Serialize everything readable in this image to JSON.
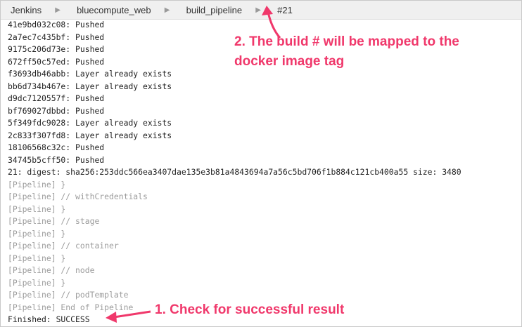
{
  "breadcrumb": {
    "items": [
      {
        "label": "Jenkins"
      },
      {
        "label": "bluecompute_web"
      },
      {
        "label": "build_pipeline"
      },
      {
        "label": "#21"
      }
    ]
  },
  "console": {
    "lines": [
      {
        "text": "41e9bd032c08: Pushed",
        "style": "normal"
      },
      {
        "text": "2a7ec7c435bf: Pushed",
        "style": "normal"
      },
      {
        "text": "9175c206d73e: Pushed",
        "style": "normal"
      },
      {
        "text": "672ff50c57ed: Pushed",
        "style": "normal"
      },
      {
        "text": "f3693db46abb: Layer already exists",
        "style": "normal"
      },
      {
        "text": "bb6d734b467e: Layer already exists",
        "style": "normal"
      },
      {
        "text": "d9dc7120557f: Pushed",
        "style": "normal"
      },
      {
        "text": "bf769027dbbd: Pushed",
        "style": "normal"
      },
      {
        "text": "5f349fdc9028: Layer already exists",
        "style": "normal"
      },
      {
        "text": "2c833f307fd8: Layer already exists",
        "style": "normal"
      },
      {
        "text": "18106568c32c: Pushed",
        "style": "normal"
      },
      {
        "text": "34745b5cff50: Pushed",
        "style": "normal"
      },
      {
        "text": "21: digest: sha256:253ddc566ea3407dae135e3b81a4843694a7a56c5bd706f1b884c121cb400a55 size: 3480",
        "style": "normal"
      },
      {
        "text": "[Pipeline] }",
        "style": "grey"
      },
      {
        "text": "[Pipeline] // withCredentials",
        "style": "grey"
      },
      {
        "text": "[Pipeline] }",
        "style": "grey"
      },
      {
        "text": "[Pipeline] // stage",
        "style": "grey"
      },
      {
        "text": "[Pipeline] }",
        "style": "grey"
      },
      {
        "text": "[Pipeline] // container",
        "style": "grey"
      },
      {
        "text": "[Pipeline] }",
        "style": "grey"
      },
      {
        "text": "[Pipeline] // node",
        "style": "grey"
      },
      {
        "text": "[Pipeline] }",
        "style": "grey"
      },
      {
        "text": "[Pipeline] // podTemplate",
        "style": "grey"
      },
      {
        "text": "[Pipeline] End of Pipeline",
        "style": "grey"
      },
      {
        "text": "Finished: SUCCESS",
        "style": "normal"
      }
    ]
  },
  "annotations": {
    "build_tag_note": "2. The build # will be mapped to the\ndocker image tag",
    "success_note": "1. Check for successful result"
  },
  "colors": {
    "annotation": "#f0386b",
    "console_text": "#222222",
    "pipeline_text": "#9c9c9c"
  }
}
